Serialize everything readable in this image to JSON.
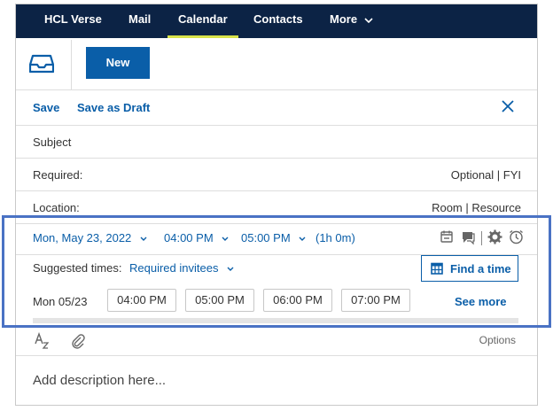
{
  "nav": {
    "items": [
      {
        "label": "HCL Verse"
      },
      {
        "label": "Mail"
      },
      {
        "label": "Calendar"
      },
      {
        "label": "Contacts"
      },
      {
        "label": "More"
      }
    ]
  },
  "toolbar": {
    "new_label": "New"
  },
  "actions": {
    "save": "Save",
    "save_draft": "Save as Draft"
  },
  "fields": {
    "subject": "Subject",
    "required": "Required:",
    "optional": "Optional | FYI",
    "location": "Location:",
    "room": "Room | Resource"
  },
  "datetime": {
    "date": "Mon, May 23, 2022",
    "start": "04:00 PM",
    "end": "05:00 PM",
    "duration": "(1h 0m)"
  },
  "suggest": {
    "label": "Suggested times:",
    "filter": "Required invitees",
    "find_time": "Find a time"
  },
  "slots": {
    "date": "Mon 05/23",
    "times": [
      "04:00 PM",
      "05:00 PM",
      "06:00 PM",
      "07:00 PM"
    ],
    "see_more": "See more"
  },
  "format": {
    "options": "Options"
  },
  "description": {
    "placeholder": "Add description here..."
  },
  "colors": {
    "nav_bg": "#0c2345",
    "accent_blue": "#0a5ea8",
    "active_underline": "#d8e24a",
    "highlight_border": "#4a72c4"
  }
}
